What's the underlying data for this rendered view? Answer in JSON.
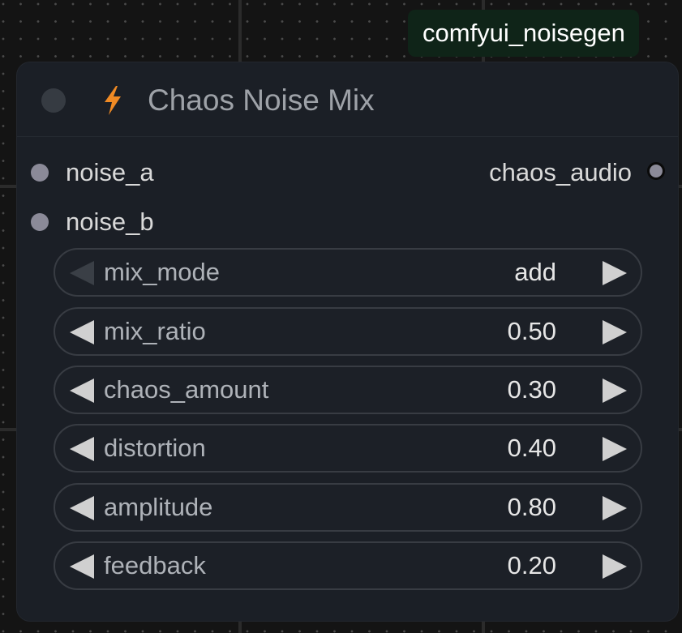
{
  "group": {
    "label": "comfyui_noisegen",
    "color": "#0f2418"
  },
  "node": {
    "title": "Chaos Noise Mix",
    "title_icon": "lightning-bolt-icon",
    "accent": "#f08a24",
    "inputs": [
      {
        "name": "noise_a"
      },
      {
        "name": "noise_b"
      }
    ],
    "outputs": [
      {
        "name": "chaos_audio"
      }
    ],
    "widgets": [
      {
        "name": "mix_mode",
        "value": "add"
      },
      {
        "name": "mix_ratio",
        "value": "0.50"
      },
      {
        "name": "chaos_amount",
        "value": "0.30"
      },
      {
        "name": "distortion",
        "value": "0.40"
      },
      {
        "name": "amplitude",
        "value": "0.80"
      },
      {
        "name": "feedback",
        "value": "0.20"
      }
    ]
  }
}
